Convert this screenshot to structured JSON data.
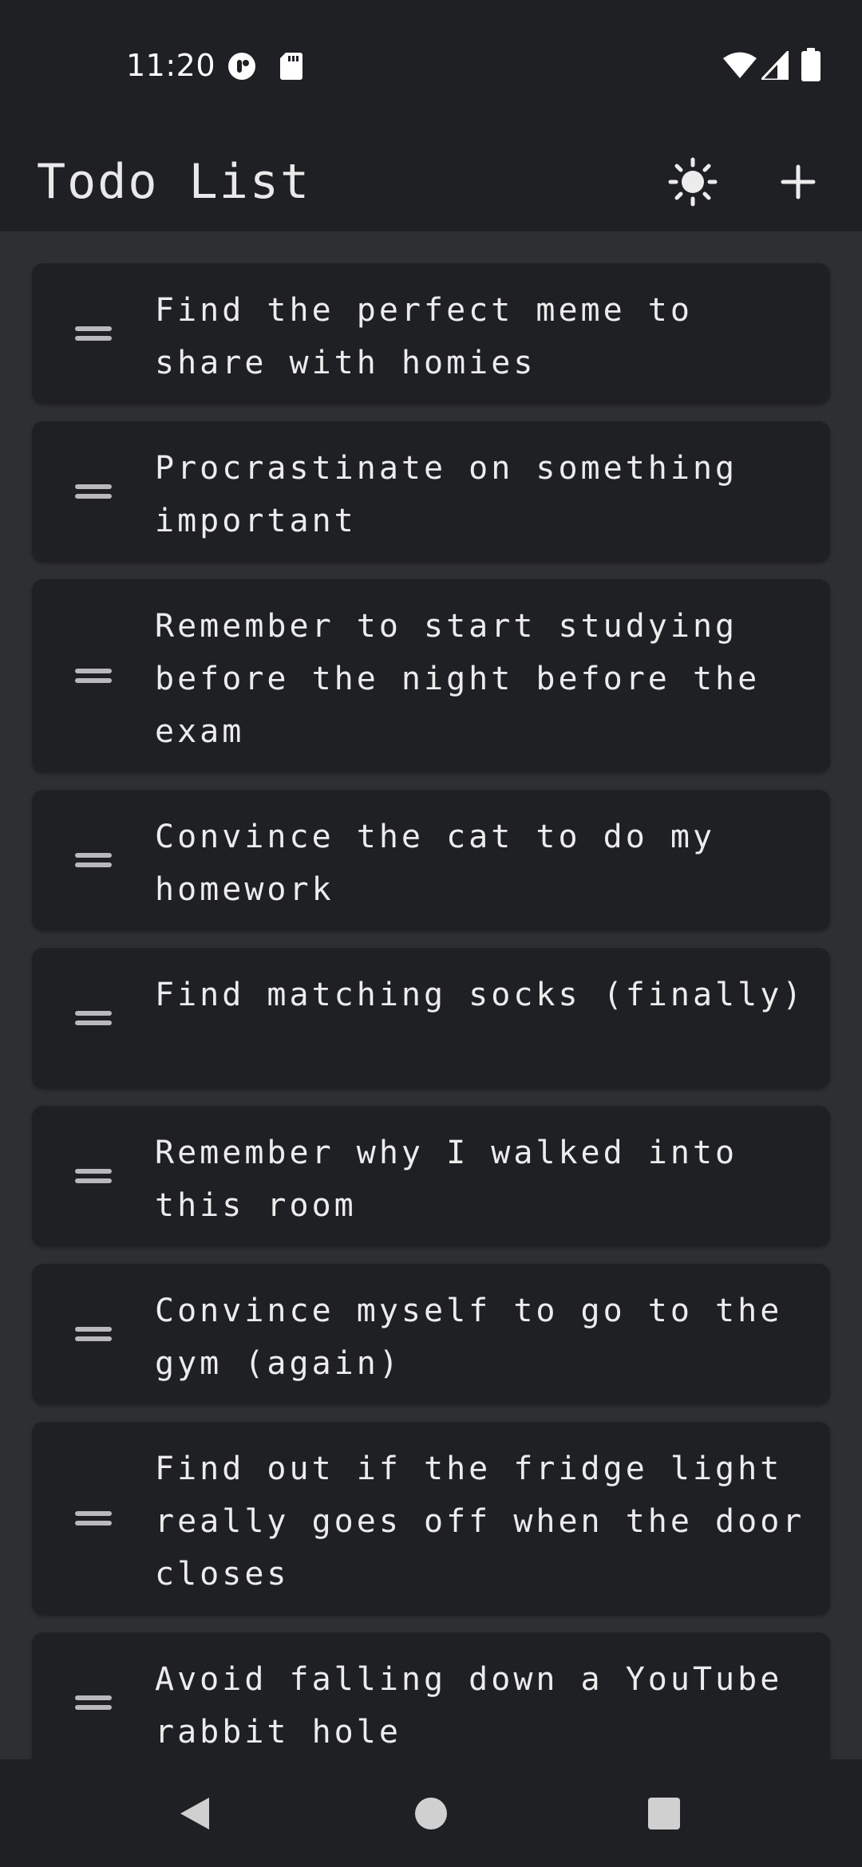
{
  "status_bar": {
    "time": "11:20",
    "icons": [
      "notification-app-icon",
      "sd-card-icon",
      "wifi-icon",
      "cellular-signal-icon",
      "battery-icon"
    ]
  },
  "app_bar": {
    "title": "Todo List",
    "theme_toggle_icon": "sun-icon",
    "add_icon": "plus-icon"
  },
  "todos": [
    {
      "text": "Find the perfect meme to share with homies"
    },
    {
      "text": "Procrastinate on something important"
    },
    {
      "text": "Remember to start studying before the night before the exam"
    },
    {
      "text": "Convince the cat to do my homework"
    },
    {
      "text": "Find matching socks (finally)"
    },
    {
      "text": "Remember why I walked into this room"
    },
    {
      "text": "Convince myself to go to the gym (again)"
    },
    {
      "text": "Find out if the fridge light really goes off when the door closes"
    },
    {
      "text": "Avoid falling down a YouTube rabbit hole"
    }
  ],
  "nav_bar": {
    "icons": [
      "back-icon",
      "home-icon",
      "recents-icon"
    ]
  },
  "colors": {
    "background": "#2e2f33",
    "surface": "#1f2023",
    "text": "#ececec",
    "handle": "#b9b9bb"
  }
}
